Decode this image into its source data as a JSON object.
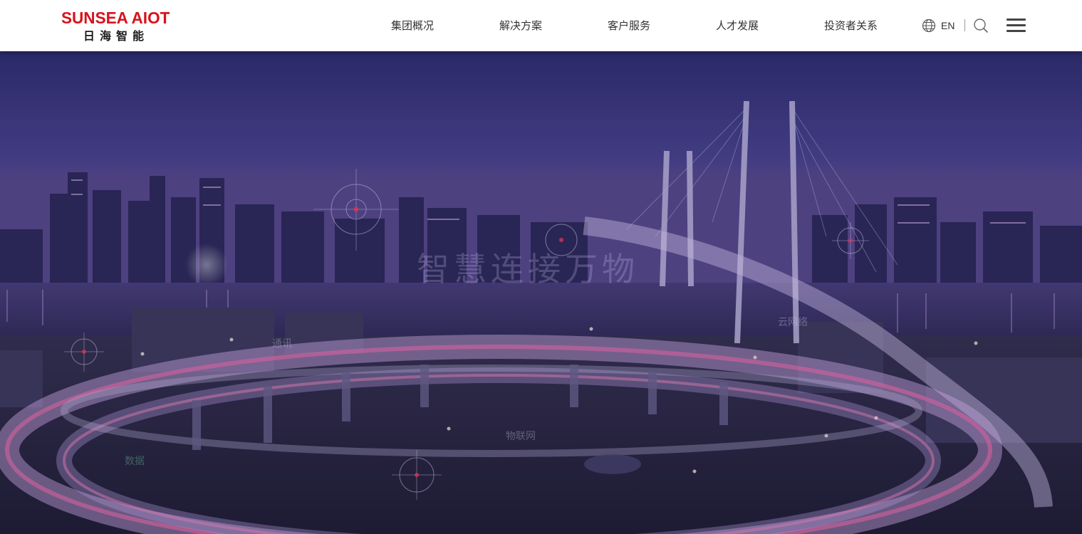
{
  "logo": {
    "en": "SUNSEA AIOT",
    "cn": "日海智能"
  },
  "nav": {
    "items": [
      {
        "label": "集团概况"
      },
      {
        "label": "解决方案"
      },
      {
        "label": "客户服务"
      },
      {
        "label": "人才发展"
      },
      {
        "label": "投资者关系"
      }
    ],
    "language": "EN",
    "icons": {
      "globe": "globe-icon",
      "search": "search-icon",
      "menu": "hamburger-menu-icon"
    }
  },
  "hero": {
    "title": "智慧连接万物",
    "tags": [
      "通讯",
      "云网络",
      "物联网",
      "数据"
    ]
  },
  "colors": {
    "brand_red": "#d8121c",
    "nav_text": "#333333"
  }
}
